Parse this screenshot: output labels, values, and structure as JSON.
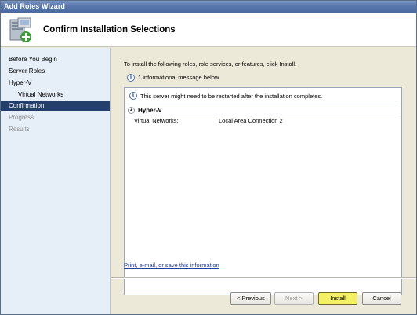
{
  "window": {
    "title": "Add Roles Wizard"
  },
  "header": {
    "title": "Confirm Installation Selections",
    "icon": "server-add-icon"
  },
  "nav": {
    "items": [
      {
        "label": "Before You Begin",
        "state": "normal"
      },
      {
        "label": "Server Roles",
        "state": "normal"
      },
      {
        "label": "Hyper-V",
        "state": "normal"
      },
      {
        "label": "Virtual Networks",
        "state": "normal",
        "indent": true
      },
      {
        "label": "Confirmation",
        "state": "selected"
      },
      {
        "label": "Progress",
        "state": "disabled"
      },
      {
        "label": "Results",
        "state": "disabled"
      }
    ]
  },
  "content": {
    "instruction": "To install the following roles, role services, or features, click Install.",
    "info_count": "1 informational message below",
    "panel": {
      "message": "This server might need to be restarted after the installation completes.",
      "section_title": "Hyper-V",
      "rows": [
        {
          "key": "Virtual Networks:",
          "value": "Local Area Connection 2"
        }
      ]
    },
    "link": "Print, e-mail, or save this information"
  },
  "buttons": {
    "previous": "< Previous",
    "next": "Next >",
    "install": "Install",
    "cancel": "Cancel"
  },
  "colors": {
    "selected_nav": "#253f6b",
    "install_highlight": "#f4f066",
    "link": "#1f3f9a"
  }
}
